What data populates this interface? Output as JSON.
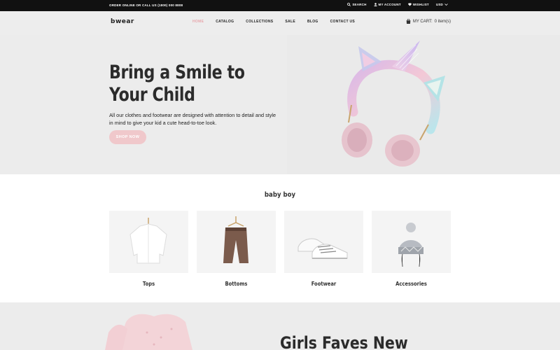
{
  "topbar": {
    "promo": "ORDER ONLINE OR CALL US (1800) 000 8808",
    "search": "SEARCH",
    "account": "MY ACCOUNT",
    "wishlist": "WISHLIST",
    "currency": "USD"
  },
  "nav": {
    "logo": "bwear",
    "items": [
      {
        "label": "HOME"
      },
      {
        "label": "CATALOG"
      },
      {
        "label": "COLLECTIONS"
      },
      {
        "label": "SALE"
      },
      {
        "label": "BLOG"
      },
      {
        "label": "CONTACT US"
      }
    ],
    "active": "HOME",
    "cart_label": "MY CART:",
    "cart_count": "0 item(s)"
  },
  "hero": {
    "title": "Bring a Smile to Your Child",
    "text": "All our clothes and footwear are designed with attention to detail and style in mind to give your kid a cute head-to-toe look.",
    "button": "SHOP NOW"
  },
  "categories": {
    "title": "baby boy",
    "items": [
      {
        "label": "Tops",
        "icon": "shirt-icon"
      },
      {
        "label": "Bottoms",
        "icon": "pants-icon"
      },
      {
        "label": "Footwear",
        "icon": "sneakers-icon"
      },
      {
        "label": "Accessories",
        "icon": "knit-hat-icon"
      }
    ]
  },
  "promo": {
    "title": "Girls Faves New"
  },
  "colors": {
    "accent": "#e8a6ac",
    "button": "#f0c8cb",
    "topbar": "#111111",
    "hero_bg": "#ececec"
  }
}
